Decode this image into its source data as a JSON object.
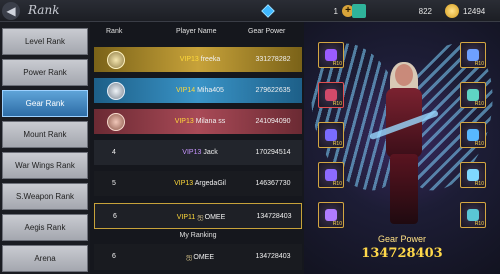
{
  "header": {
    "title": "Rank",
    "currencies": [
      {
        "icon": "diamond-icon",
        "value": "1"
      },
      {
        "icon": "ticket-icon",
        "value": "822"
      },
      {
        "icon": "gold-coin-icon",
        "value": "12494"
      }
    ]
  },
  "menu": {
    "items": [
      {
        "label": "Level Rank"
      },
      {
        "label": "Power Rank"
      },
      {
        "label": "Gear Rank",
        "active": true
      },
      {
        "label": "Mount Rank"
      },
      {
        "label": "War Wings Rank"
      },
      {
        "label": "S.Weapon Rank"
      },
      {
        "label": "Aegis Rank"
      },
      {
        "label": "Arena"
      }
    ]
  },
  "table": {
    "headers": {
      "rank": "Rank",
      "player": "Player Name",
      "power": "Gear Power"
    },
    "rows": [
      {
        "rank": "",
        "vip": "VIP13",
        "name": "freeka",
        "power": "331278282"
      },
      {
        "rank": "",
        "vip": "VIP14",
        "name": "Miha405",
        "power": "279622635"
      },
      {
        "rank": "",
        "vip": "VIP13",
        "name": "Milana ss",
        "power": "241094090"
      },
      {
        "rank": "4",
        "vip": "VIP13",
        "name": "Jack",
        "power": "170294514"
      },
      {
        "rank": "5",
        "vip": "VIP13",
        "name": "ArgedaGil",
        "power": "146367730"
      },
      {
        "rank": "6",
        "vip": "VIP11",
        "name": "OMEE",
        "power": "134728403"
      }
    ],
    "my_ranking_label": "My Ranking",
    "my_ranking": {
      "rank": "6",
      "name": "OMEE",
      "power": "134728403"
    }
  },
  "character": {
    "gear_power_label": "Gear Power",
    "gear_power_value": "134728403",
    "slot_levels": [
      "R10",
      "R10",
      "R10",
      "R10",
      "R10",
      "R10",
      "R10",
      "R10",
      "R10",
      "R10"
    ]
  },
  "colors": {
    "accent_gold": "#ffd84a",
    "active_tab": "#3a86c4",
    "vip_yellow": "#ffd93a",
    "vip_purple": "#c795ff"
  }
}
